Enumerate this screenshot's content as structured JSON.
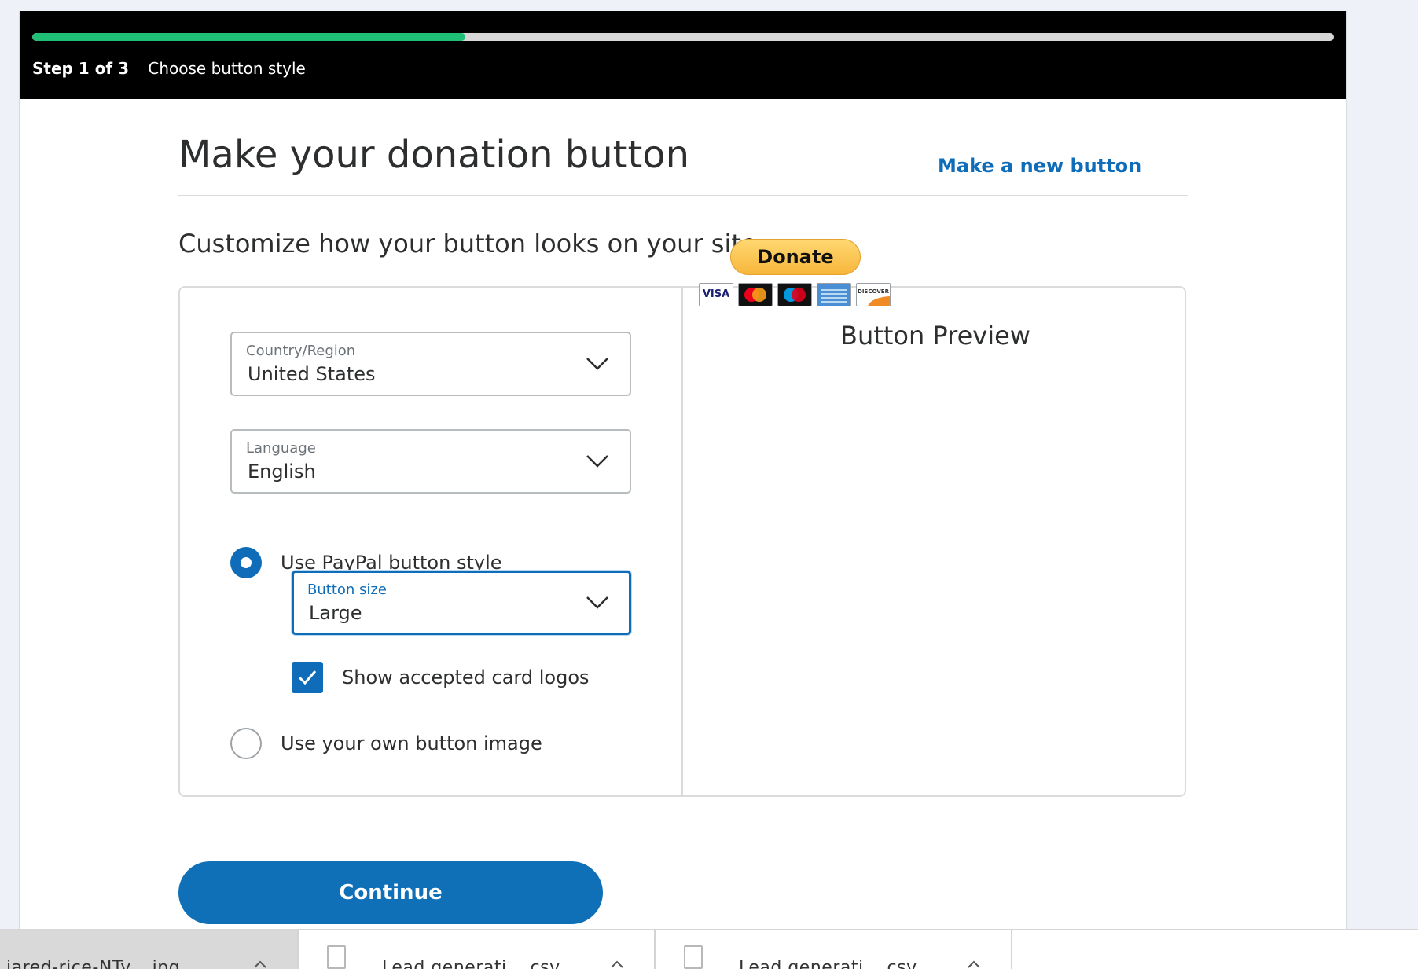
{
  "header": {
    "step_count": "Step 1 of 3",
    "step_name": "Choose button style",
    "progress_fraction": 0.333
  },
  "page": {
    "title": "Make your donation button",
    "new_button_link": "Make a new button",
    "subtitle": "Customize how your button looks on your site"
  },
  "form": {
    "country": {
      "label": "Country/Region",
      "value": "United States"
    },
    "language": {
      "label": "Language",
      "value": "English"
    },
    "paypal_style": {
      "label": "Use PayPal button style",
      "selected": true
    },
    "button_size": {
      "label": "Button size",
      "value": "Large"
    },
    "card_logos": {
      "label": "Show accepted card logos",
      "checked": true
    },
    "own_image": {
      "label": "Use your own button image",
      "selected": false
    }
  },
  "preview": {
    "title": "Button Preview",
    "donate_label": "Donate",
    "card_logos": [
      "visa-logo-icon",
      "mastercard-logo-icon",
      "maestro-logo-icon",
      "amex-logo-icon",
      "discover-logo-icon"
    ],
    "visa_text": "VISA",
    "discover_text": "DISCOVER"
  },
  "actions": {
    "continue_label": "Continue"
  },
  "downloads": {
    "items": [
      {
        "name": "jared-rice-NTy....jpg"
      },
      {
        "name": "Lead generati....csv"
      },
      {
        "name": "Lead generati....csv"
      }
    ]
  },
  "colors": {
    "accent": "#0f6cb8",
    "progress": "#1fbf75",
    "donate_yellow": "#f7b63b"
  }
}
